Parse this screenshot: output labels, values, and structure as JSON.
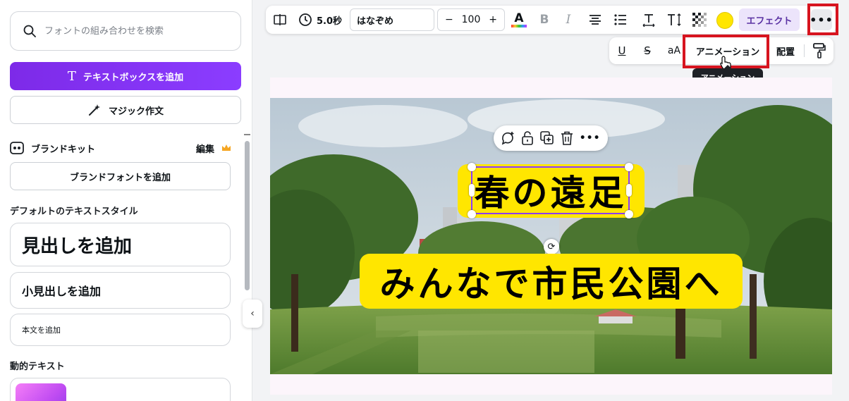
{
  "sidebar": {
    "search_placeholder": "フォントの組み合わせを検索",
    "add_textbox": "テキストボックスを追加",
    "magic_write": "マジック作文",
    "brand_kit": "ブランドキット",
    "brand_edit": "編集",
    "add_brand_font": "ブランドフォントを追加",
    "default_styles_title": "デフォルトのテキストスタイル",
    "add_heading": "見出しを追加",
    "add_subheading": "小見出しを追加",
    "add_body": "本文を追加",
    "dynamic_text_title": "動的テキスト"
  },
  "toolbar": {
    "duration": "5.0秒",
    "font_name": "はなぞめ",
    "font_size": "100",
    "minus": "−",
    "plus": "+",
    "text_color_letter": "A",
    "bold": "B",
    "italic": "I",
    "effects": "エフェクト",
    "more": "•••",
    "text_color": "#ffe600"
  },
  "toolbar2": {
    "underline": "U",
    "strikethrough": "S",
    "case": "aA",
    "animation": "アニメーション",
    "position": "配置"
  },
  "tooltip": "アニメーション",
  "canvas": {
    "title": "春の遠足",
    "subtitle": "みんなで市民公園へ"
  },
  "colors": {
    "accent": "#8b3dff",
    "highlight": "#d7141f",
    "text_bg": "#ffe600"
  }
}
